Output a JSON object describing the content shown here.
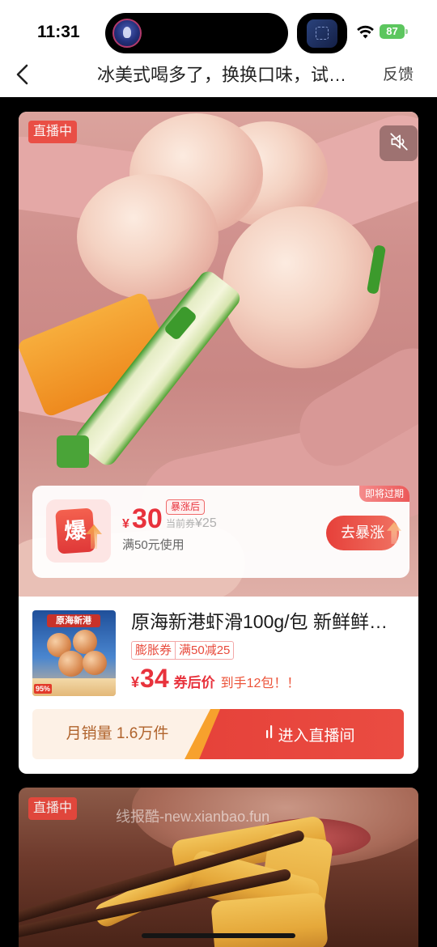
{
  "status": {
    "time": "11:31",
    "battery": "87",
    "wifi_icon": "wifi-icon",
    "battery_icon": "battery-icon"
  },
  "nav": {
    "back_icon": "chevron-left-icon",
    "title": "冰美式喝多了，换换口味，试…",
    "feedback": "反馈"
  },
  "theme": {
    "accent": "#e8323c",
    "live_badge": "#eb463c",
    "battery": "#5cc65e",
    "sales_bg": "#fdf1e6"
  },
  "cards": [
    {
      "live_badge": "直播中",
      "mute_icon": "speaker-muted-icon",
      "coupon": {
        "expire_tag": "即将过期",
        "icon_text": "爆",
        "currency": "¥",
        "amount": "30",
        "after_tag": "暴涨后",
        "current_label": "当前券",
        "current_value": "¥25",
        "condition": "满50元使用",
        "button": "去暴涨"
      },
      "product": {
        "thumbnail": {
          "banner": "原海新港",
          "badge": "95%"
        },
        "title": "原海新港虾滑100g/包 新鲜鲜…",
        "tags": [
          "膨胀券",
          "满50减25"
        ],
        "price_currency": "¥",
        "price": "34",
        "price_label": "券后价",
        "promo": "到手12包！！"
      },
      "monthly_sales": "月销量 1.6万件",
      "enter_live_icon": "live-bars-icon",
      "enter_live": "进入直播间"
    },
    {
      "live_badge": "直播中"
    }
  ],
  "watermark": "线报酷-new.xianbao.fun"
}
